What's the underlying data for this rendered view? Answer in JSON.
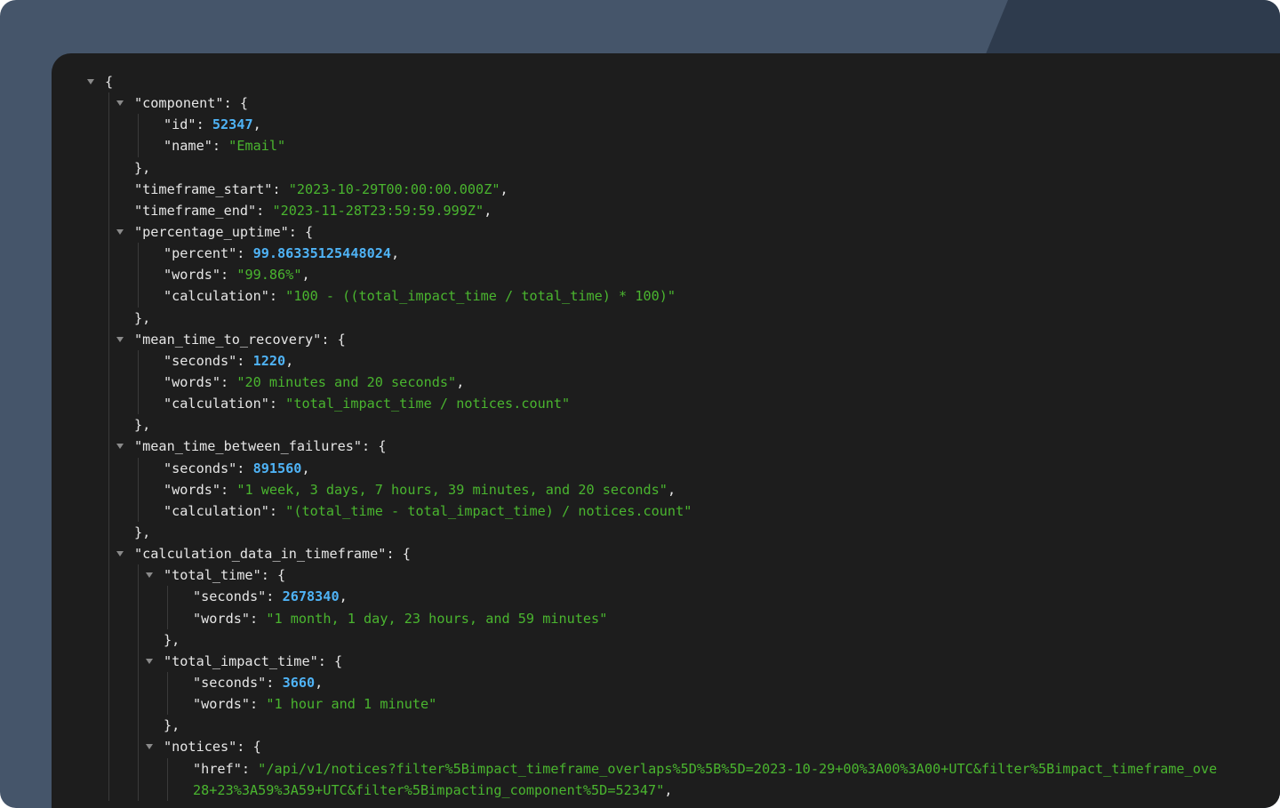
{
  "viewer": {
    "lines": [
      {
        "depth": 0,
        "toggle": true,
        "parts": [
          {
            "t": "{",
            "c": "p"
          }
        ]
      },
      {
        "depth": 1,
        "toggle": true,
        "parts": [
          {
            "t": "\"component\"",
            "c": "k"
          },
          {
            "t": ": {",
            "c": "p"
          }
        ]
      },
      {
        "depth": 2,
        "toggle": false,
        "parts": [
          {
            "t": "\"id\"",
            "c": "k"
          },
          {
            "t": ": ",
            "c": "p"
          },
          {
            "t": "52347",
            "c": "n"
          },
          {
            "t": ",",
            "c": "p"
          }
        ]
      },
      {
        "depth": 2,
        "toggle": false,
        "parts": [
          {
            "t": "\"name\"",
            "c": "k"
          },
          {
            "t": ": ",
            "c": "p"
          },
          {
            "t": "\"Email\"",
            "c": "s"
          }
        ]
      },
      {
        "depth": 1,
        "toggle": false,
        "parts": [
          {
            "t": "},",
            "c": "p"
          }
        ]
      },
      {
        "depth": 1,
        "toggle": false,
        "parts": [
          {
            "t": "\"timeframe_start\"",
            "c": "k"
          },
          {
            "t": ": ",
            "c": "p"
          },
          {
            "t": "\"2023-10-29T00:00:00.000Z\"",
            "c": "s"
          },
          {
            "t": ",",
            "c": "p"
          }
        ]
      },
      {
        "depth": 1,
        "toggle": false,
        "parts": [
          {
            "t": "\"timeframe_end\"",
            "c": "k"
          },
          {
            "t": ": ",
            "c": "p"
          },
          {
            "t": "\"2023-11-28T23:59:59.999Z\"",
            "c": "s"
          },
          {
            "t": ",",
            "c": "p"
          }
        ]
      },
      {
        "depth": 1,
        "toggle": true,
        "parts": [
          {
            "t": "\"percentage_uptime\"",
            "c": "k"
          },
          {
            "t": ": {",
            "c": "p"
          }
        ]
      },
      {
        "depth": 2,
        "toggle": false,
        "parts": [
          {
            "t": "\"percent\"",
            "c": "k"
          },
          {
            "t": ": ",
            "c": "p"
          },
          {
            "t": "99.86335125448024",
            "c": "n"
          },
          {
            "t": ",",
            "c": "p"
          }
        ]
      },
      {
        "depth": 2,
        "toggle": false,
        "parts": [
          {
            "t": "\"words\"",
            "c": "k"
          },
          {
            "t": ": ",
            "c": "p"
          },
          {
            "t": "\"99.86%\"",
            "c": "s"
          },
          {
            "t": ",",
            "c": "p"
          }
        ]
      },
      {
        "depth": 2,
        "toggle": false,
        "parts": [
          {
            "t": "\"calculation\"",
            "c": "k"
          },
          {
            "t": ": ",
            "c": "p"
          },
          {
            "t": "\"100 - ((total_impact_time / total_time) * 100)\"",
            "c": "s"
          }
        ]
      },
      {
        "depth": 1,
        "toggle": false,
        "parts": [
          {
            "t": "},",
            "c": "p"
          }
        ]
      },
      {
        "depth": 1,
        "toggle": true,
        "parts": [
          {
            "t": "\"mean_time_to_recovery\"",
            "c": "k"
          },
          {
            "t": ": {",
            "c": "p"
          }
        ]
      },
      {
        "depth": 2,
        "toggle": false,
        "parts": [
          {
            "t": "\"seconds\"",
            "c": "k"
          },
          {
            "t": ": ",
            "c": "p"
          },
          {
            "t": "1220",
            "c": "n"
          },
          {
            "t": ",",
            "c": "p"
          }
        ]
      },
      {
        "depth": 2,
        "toggle": false,
        "parts": [
          {
            "t": "\"words\"",
            "c": "k"
          },
          {
            "t": ": ",
            "c": "p"
          },
          {
            "t": "\"20 minutes and 20 seconds\"",
            "c": "s"
          },
          {
            "t": ",",
            "c": "p"
          }
        ]
      },
      {
        "depth": 2,
        "toggle": false,
        "parts": [
          {
            "t": "\"calculation\"",
            "c": "k"
          },
          {
            "t": ": ",
            "c": "p"
          },
          {
            "t": "\"total_impact_time / notices.count\"",
            "c": "s"
          }
        ]
      },
      {
        "depth": 1,
        "toggle": false,
        "parts": [
          {
            "t": "},",
            "c": "p"
          }
        ]
      },
      {
        "depth": 1,
        "toggle": true,
        "parts": [
          {
            "t": "\"mean_time_between_failures\"",
            "c": "k"
          },
          {
            "t": ": {",
            "c": "p"
          }
        ]
      },
      {
        "depth": 2,
        "toggle": false,
        "parts": [
          {
            "t": "\"seconds\"",
            "c": "k"
          },
          {
            "t": ": ",
            "c": "p"
          },
          {
            "t": "891560",
            "c": "n"
          },
          {
            "t": ",",
            "c": "p"
          }
        ]
      },
      {
        "depth": 2,
        "toggle": false,
        "parts": [
          {
            "t": "\"words\"",
            "c": "k"
          },
          {
            "t": ": ",
            "c": "p"
          },
          {
            "t": "\"1 week, 3 days, 7 hours, 39 minutes, and 20 seconds\"",
            "c": "s"
          },
          {
            "t": ",",
            "c": "p"
          }
        ]
      },
      {
        "depth": 2,
        "toggle": false,
        "parts": [
          {
            "t": "\"calculation\"",
            "c": "k"
          },
          {
            "t": ": ",
            "c": "p"
          },
          {
            "t": "\"(total_time - total_impact_time) / notices.count\"",
            "c": "s"
          }
        ]
      },
      {
        "depth": 1,
        "toggle": false,
        "parts": [
          {
            "t": "},",
            "c": "p"
          }
        ]
      },
      {
        "depth": 1,
        "toggle": true,
        "parts": [
          {
            "t": "\"calculation_data_in_timeframe\"",
            "c": "k"
          },
          {
            "t": ": {",
            "c": "p"
          }
        ]
      },
      {
        "depth": 2,
        "toggle": true,
        "parts": [
          {
            "t": "\"total_time\"",
            "c": "k"
          },
          {
            "t": ": {",
            "c": "p"
          }
        ]
      },
      {
        "depth": 3,
        "toggle": false,
        "parts": [
          {
            "t": "\"seconds\"",
            "c": "k"
          },
          {
            "t": ": ",
            "c": "p"
          },
          {
            "t": "2678340",
            "c": "n"
          },
          {
            "t": ",",
            "c": "p"
          }
        ]
      },
      {
        "depth": 3,
        "toggle": false,
        "parts": [
          {
            "t": "\"words\"",
            "c": "k"
          },
          {
            "t": ": ",
            "c": "p"
          },
          {
            "t": "\"1 month, 1 day, 23 hours, and 59 minutes\"",
            "c": "s"
          }
        ]
      },
      {
        "depth": 2,
        "toggle": false,
        "parts": [
          {
            "t": "},",
            "c": "p"
          }
        ]
      },
      {
        "depth": 2,
        "toggle": true,
        "parts": [
          {
            "t": "\"total_impact_time\"",
            "c": "k"
          },
          {
            "t": ": {",
            "c": "p"
          }
        ]
      },
      {
        "depth": 3,
        "toggle": false,
        "parts": [
          {
            "t": "\"seconds\"",
            "c": "k"
          },
          {
            "t": ": ",
            "c": "p"
          },
          {
            "t": "3660",
            "c": "n"
          },
          {
            "t": ",",
            "c": "p"
          }
        ]
      },
      {
        "depth": 3,
        "toggle": false,
        "parts": [
          {
            "t": "\"words\"",
            "c": "k"
          },
          {
            "t": ": ",
            "c": "p"
          },
          {
            "t": "\"1 hour and 1 minute\"",
            "c": "s"
          }
        ]
      },
      {
        "depth": 2,
        "toggle": false,
        "parts": [
          {
            "t": "},",
            "c": "p"
          }
        ]
      },
      {
        "depth": 2,
        "toggle": true,
        "parts": [
          {
            "t": "\"notices\"",
            "c": "k"
          },
          {
            "t": ": {",
            "c": "p"
          }
        ]
      },
      {
        "depth": 3,
        "toggle": false,
        "parts": [
          {
            "t": "\"href\"",
            "c": "k"
          },
          {
            "t": ": ",
            "c": "p"
          },
          {
            "t": "\"/api/v1/notices?filter%5Bimpact_timeframe_overlaps%5D%5B%5D=2023-10-29+00%3A00%3A00+UTC&filter%5Bimpact_timeframe_ove",
            "c": "s"
          }
        ]
      },
      {
        "depth": 3,
        "toggle": false,
        "parts": [
          {
            "t": "28+23%3A59%3A59+UTC&filter%5Bimpacting_component%5D=52347\"",
            "c": "s"
          },
          {
            "t": ",",
            "c": "p"
          }
        ]
      }
    ]
  },
  "colors": {
    "background": "#45556a",
    "panel": "#1d1d1d",
    "key": "#e6e6e6",
    "number": "#4fb3f6",
    "string": "#4ab52f"
  }
}
